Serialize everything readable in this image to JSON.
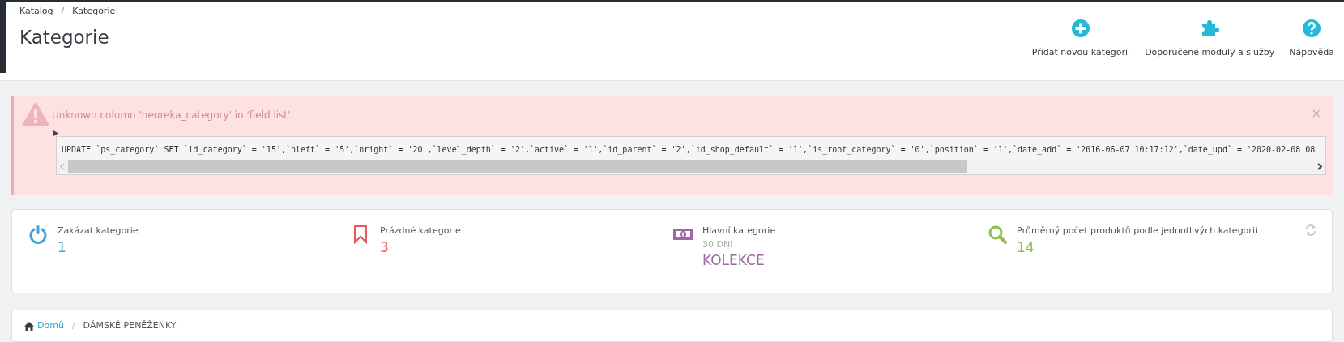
{
  "breadcrumb": [
    "Katalog",
    "Kategorie"
  ],
  "breadcrumb_separator": "/",
  "title": "Kategorie",
  "toolbar": [
    {
      "kind": "plus",
      "label": "Přidat novou kategorii"
    },
    {
      "kind": "puzzle",
      "label": "Doporučené moduly a služby"
    },
    {
      "kind": "help",
      "label": "Nápověda"
    }
  ],
  "alert": {
    "message": "Unknown column 'heureka_category' in 'field list'",
    "close": "×",
    "code": "UPDATE `ps_category` SET `id_category` = '15',`nleft` = '5',`nright` = '20',`level_depth` = '2',`active` = '1',`id_parent` = '2',`id_shop_default` = '1',`is_root_category` = '0',`position` = '1',`date_add` = '2016-06-07 10:17:12',`date_upd` = '2020-02-08 08"
  },
  "kpis": [
    {
      "kind": "power",
      "color": "#3ea4dd",
      "label": "Zakázat kategorie",
      "value": "1"
    },
    {
      "kind": "bookmark",
      "color": "#e8575f",
      "label": "Prázdné kategorie",
      "value": "3"
    },
    {
      "kind": "money",
      "color": "#9e68a4",
      "label": "Hlavní kategorie",
      "subtitle": "30 DNÍ",
      "value": "KOLEKCE"
    },
    {
      "kind": "search",
      "color": "#8cc152",
      "label": "Průměrný počet produktů podle jednotlivých kategorií",
      "value": "14"
    }
  ],
  "path": {
    "home": "Domů",
    "separator": "/",
    "current": "DÁMSKÉ PENĚŽENKY"
  }
}
